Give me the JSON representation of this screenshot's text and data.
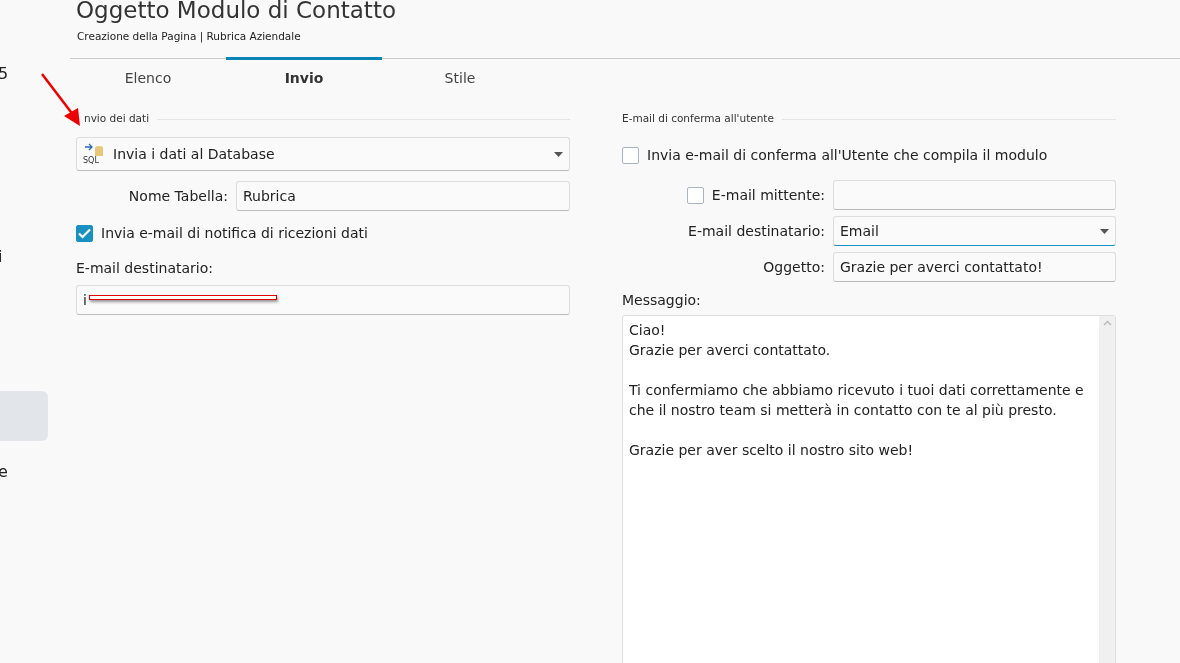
{
  "left_edge": {
    "texts": [
      "5",
      "i",
      "e"
    ]
  },
  "header": {
    "title": "Oggetto Modulo di Contatto",
    "subtitle": "Creazione della Pagina | Rubrica Aziendale"
  },
  "tabs": [
    {
      "label": "Elenco",
      "selected": false
    },
    {
      "label": "Invio",
      "selected": true
    },
    {
      "label": "Stile",
      "selected": false
    }
  ],
  "send_data": {
    "section_title": "nvio dei dati",
    "method": {
      "icon_text": "SQL",
      "value": "Invia i dati al Database"
    },
    "table_name": {
      "label": "Nome Tabella:",
      "value": "Rubrica"
    },
    "notify": {
      "label": "Invia e-mail di notifica di ricezioni dati",
      "checked": true
    },
    "recipient": {
      "label": "E-mail destinatario:",
      "value": "i"
    }
  },
  "confirmation": {
    "section_title": "E-mail di conferma all'utente",
    "send_confirmation": {
      "label": "Invia e-mail di conferma all'Utente che compila il modulo",
      "checked": false
    },
    "sender": {
      "label": "E-mail mittente:",
      "checked": false
    },
    "recipient": {
      "label": "E-mail destinatario:",
      "value": "Email"
    },
    "subject": {
      "label": "Oggetto:",
      "value": "Grazie per averci contattato!"
    },
    "message": {
      "label": "Messaggio:",
      "value": "Ciao!\nGrazie per averci contattato.\n\nTi confermiamo che abbiamo ricevuto i tuoi dati correttamente e che il nostro team si metterà in contatto con te al più presto.\n\nGrazie per aver scelto il nostro sito web!"
    }
  }
}
